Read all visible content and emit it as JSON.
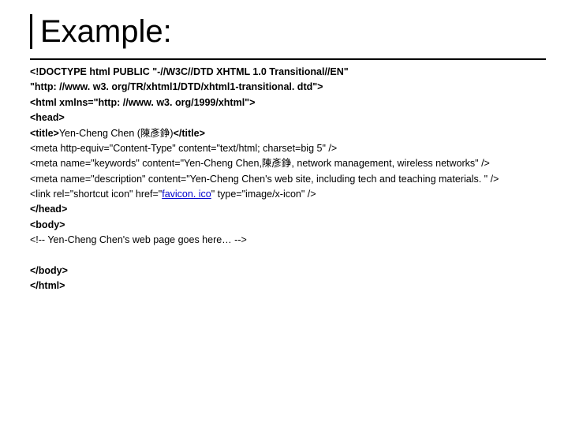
{
  "title": "Example:",
  "code_lines": [
    {
      "text": "<!DOCTYPE html PUBLIC \"-//W3C//DTD XHTML 1.0 Transitional//EN\"",
      "bold": true
    },
    {
      "text": "\"http: //www. w3. org/TR/xhtml1/DTD/xhtml1-transitional. dtd\">",
      "bold": true
    },
    {
      "text": "<html xmlns=\"http: //www. w3. org/1999/xhtml\">",
      "bold": true
    },
    {
      "text": "<head>",
      "bold": true
    },
    {
      "prefix_bold": "<title>",
      "mid": "Yen-Cheng Chen (陳彥錚)",
      "suffix_bold": "</title>"
    },
    {
      "text": "<meta http-equiv=\"Content-Type\" content=\"text/html; charset=big 5\" />"
    },
    {
      "text": "<meta name=\"keywords\" content=\"Yen-Cheng Chen,陳彥錚, network management, wireless networks\" />"
    },
    {
      "text": "<meta name=\"description\" content=\"Yen-Cheng Chen's web site, including tech and teaching materials. \" />"
    },
    {
      "link_line": true,
      "pre": "<link rel=\"shortcut icon\" href=\"",
      "link": "favicon. ico",
      "post": "\" type=\"image/x-icon\" />"
    },
    {
      "text": "</head>",
      "bold": true
    },
    {
      "text": "<body>",
      "bold": true
    },
    {
      "text": "<!-- Yen-Cheng Chen's web page goes here… -->"
    },
    {
      "text": ""
    },
    {
      "text": "</body>",
      "bold": true
    },
    {
      "text": "</html>",
      "bold": true
    }
  ]
}
